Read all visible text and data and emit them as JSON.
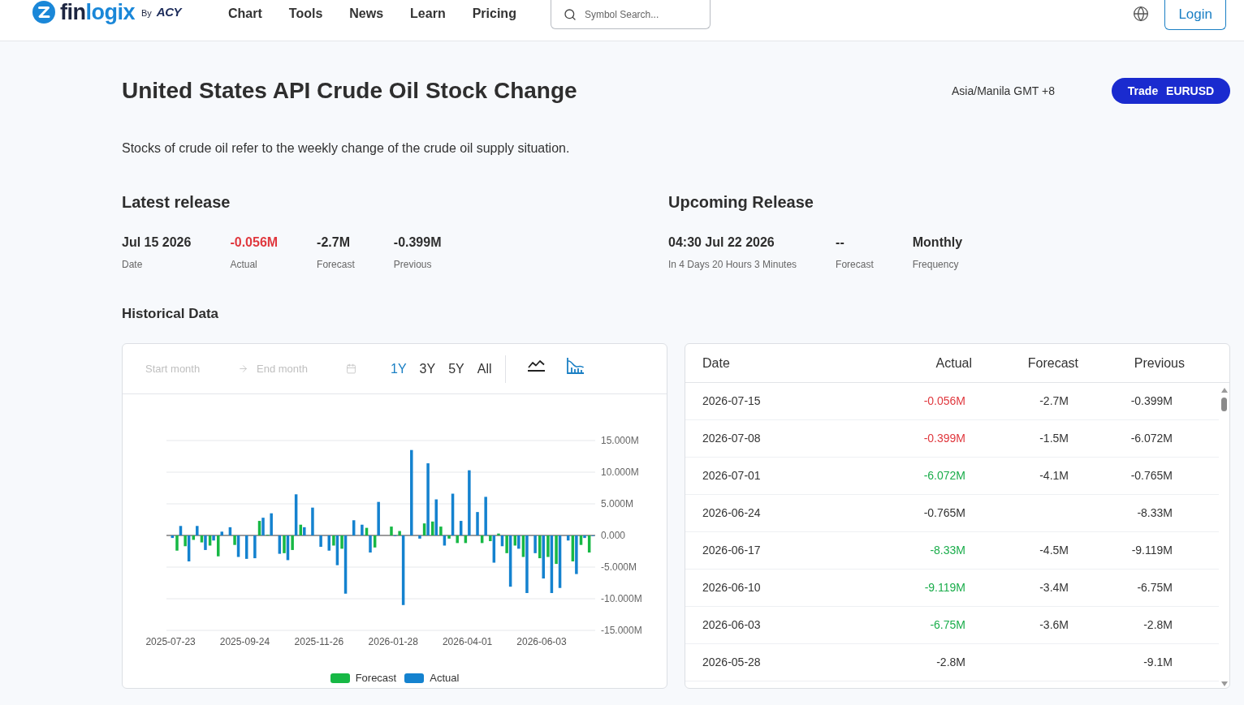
{
  "header": {
    "logo": {
      "wordmark": [
        "fin",
        "logix"
      ],
      "byline": "By",
      "partner": "ACY"
    },
    "nav": [
      "Chart",
      "Tools",
      "News",
      "Learn",
      "Pricing"
    ],
    "search": {
      "placeholder": "Symbol Search..."
    },
    "login_button": "Login"
  },
  "event": {
    "title": "United States API Crude Oil Stock Change",
    "timezone": "Asia/Manila GMT +8",
    "trade_button": {
      "action": "Trade",
      "symbol": "EURUSD"
    },
    "description": "Stocks of crude oil refer to the weekly change of the crude oil supply situation."
  },
  "latest_release": {
    "heading": "Latest release",
    "stats": [
      {
        "value": "Jul 15 2026",
        "label": "Date",
        "color": "#2e2e2e"
      },
      {
        "value": "-0.056M",
        "label": "Actual",
        "color": "#e0383e"
      },
      {
        "value": "-2.7M",
        "label": "Forecast",
        "color": "#2e2e2e"
      },
      {
        "value": "-0.399M",
        "label": "Previous",
        "color": "#2e2e2e"
      }
    ]
  },
  "upcoming_release": {
    "heading": "Upcoming Release",
    "stats": [
      {
        "value": "04:30 Jul 22 2026",
        "label": "In 4 Days 20 Hours 3 Minutes",
        "color": "#2e2e2e"
      },
      {
        "value": "--",
        "label": "Forecast",
        "color": "#2e2e2e"
      },
      {
        "value": "Monthly",
        "label": "Frequency",
        "color": "#2e2e2e"
      }
    ]
  },
  "historical": {
    "heading": "Historical Data",
    "chart_panel": {
      "start_month": {
        "placeholder": "Start month"
      },
      "end_month": {
        "placeholder": "End month"
      },
      "ranges": [
        {
          "label": "1Y",
          "selected": true
        },
        {
          "label": "3Y",
          "selected": false
        },
        {
          "label": "5Y",
          "selected": false
        },
        {
          "label": "All",
          "selected": false
        }
      ],
      "chart_types": [
        {
          "kind": "line",
          "selected": false
        },
        {
          "kind": "bar",
          "selected": true
        }
      ],
      "chart_data": {
        "type": "bar",
        "categories": [
          "2025-07-23",
          null,
          null,
          null,
          null,
          null,
          null,
          null,
          null,
          "2025-09-24",
          null,
          null,
          null,
          null,
          null,
          null,
          null,
          null,
          "2025-11-26",
          null,
          null,
          null,
          null,
          null,
          null,
          null,
          null,
          "2026-01-28",
          null,
          null,
          null,
          null,
          null,
          null,
          null,
          null,
          "2026-04-01",
          null,
          null,
          null,
          null,
          null,
          null,
          null,
          null,
          "2026-06-03",
          null,
          null,
          null,
          null,
          null,
          null
        ],
        "ylim": [
          -15,
          15
        ],
        "yticks": [
          {
            "value": 15,
            "label": "15.000M"
          },
          {
            "value": 10,
            "label": "10.000M"
          },
          {
            "value": 5,
            "label": "5.000M"
          },
          {
            "value": 0,
            "label": "0.000"
          },
          {
            "value": -5,
            "label": "-5.000M"
          },
          {
            "value": -10,
            "label": "-10.000M"
          },
          {
            "value": -15,
            "label": "-15.000M"
          }
        ],
        "grid": true,
        "legend": "bottom",
        "series": [
          {
            "name": "Forecast",
            "color": "#17b845",
            "values": [
              null,
              -2.4,
              -1.7,
              -0.7,
              -1.1,
              -1.6,
              -3.3,
              null,
              -1.5,
              null,
              null,
              2.3,
              0.1,
              null,
              -2.8,
              -2.3,
              1.7,
              null,
              null,
              null,
              -1.6,
              -2.1,
              null,
              null,
              1.2,
              -1.9,
              null,
              1.4,
              0.7,
              null,
              null,
              1.9,
              2.2,
              1.4,
              -0.5,
              -1.2,
              -1.2,
              null,
              -1.2,
              -0.9,
              0.3,
              -2.8,
              -1.6,
              -3.4,
              null,
              -3.6,
              -3.4,
              -4.5,
              null,
              -4.1,
              -1.5,
              -2.7
            ]
          },
          {
            "name": "Actual",
            "color": "#1482cf",
            "values": [
              -0.4,
              1.5,
              -4.1,
              1.5,
              -2.3,
              -0.8,
              0.6,
              1.3,
              -3.4,
              -3.7,
              -3.6,
              2.8,
              3.5,
              -2.9,
              -3.9,
              6.5,
              1.3,
              4.4,
              -1.8,
              -2.4,
              -4.7,
              -9.2,
              2.4,
              1.7,
              -2.7,
              5.3,
              null,
              -0.1,
              -11,
              13.5,
              -0.5,
              11.4,
              5.7,
              -1.6,
              6.6,
              2.3,
              10.3,
              3.7,
              6.1,
              -4.3,
              -1.7,
              -8.1,
              -2.1,
              -9.1,
              -2.8,
              -6.8,
              -9.1,
              -8.3,
              -0.8,
              -6.1,
              -0.4,
              -0.1
            ]
          }
        ]
      }
    },
    "table": {
      "columns": [
        "Date",
        "Actual",
        "Forecast",
        "Previous"
      ],
      "rows": [
        {
          "date": "2026-07-15",
          "actual": {
            "value": "-0.056M",
            "color": "#e0383e"
          },
          "forecast": "-2.7M",
          "previous": "-0.399M"
        },
        {
          "date": "2026-07-08",
          "actual": {
            "value": "-0.399M",
            "color": "#e0383e"
          },
          "forecast": "-1.5M",
          "previous": "-6.072M"
        },
        {
          "date": "2026-07-01",
          "actual": {
            "value": "-6.072M",
            "color": "#1aad4b"
          },
          "forecast": "-4.1M",
          "previous": "-0.765M"
        },
        {
          "date": "2026-06-24",
          "actual": {
            "value": "-0.765M",
            "color": "#333333"
          },
          "previous": "-8.33M"
        },
        {
          "date": "2026-06-17",
          "actual": {
            "value": "-8.33M",
            "color": "#1aad4b"
          },
          "forecast": "-4.5M",
          "previous": "-9.119M"
        },
        {
          "date": "2026-06-10",
          "actual": {
            "value": "-9.119M",
            "color": "#1aad4b"
          },
          "forecast": "-3.4M",
          "previous": "-6.75M"
        },
        {
          "date": "2026-06-03",
          "actual": {
            "value": "-6.75M",
            "color": "#1aad4b"
          },
          "forecast": "-3.6M",
          "previous": "-2.8M"
        },
        {
          "date": "2026-05-28",
          "actual": {
            "value": "-2.8M",
            "color": "#333333"
          },
          "previous": "-9.1M"
        }
      ]
    }
  }
}
